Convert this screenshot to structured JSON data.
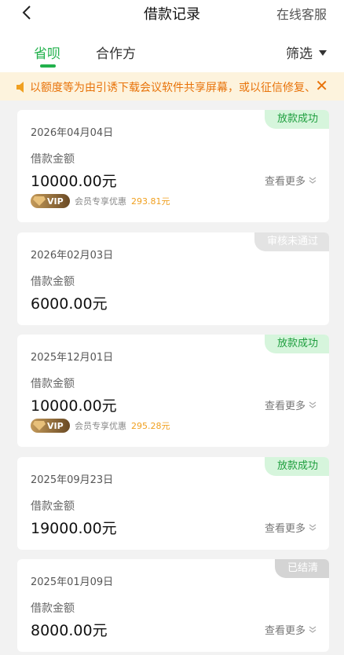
{
  "header": {
    "title": "借款记录",
    "service_label": "在线客服"
  },
  "tabs": [
    {
      "label": "省呗",
      "active": true
    },
    {
      "label": "合作方",
      "active": false
    }
  ],
  "filter_label": "筛选",
  "notice": {
    "text": "以额度等为由引诱下载会议软件共享屏幕，或以征信修复、"
  },
  "common": {
    "amount_label": "借款金额",
    "more_label": "查看更多",
    "vip_label": "VIP",
    "vip_text": "会员专享优惠"
  },
  "records": [
    {
      "date": "2026年04月04日",
      "amount": "10000.00元",
      "status": "放款成功",
      "vip_amount": "293.81元"
    },
    {
      "date": "2026年02月03日",
      "amount": "6000.00元",
      "status": "审核未通过"
    },
    {
      "date": "2025年12月01日",
      "amount": "10000.00元",
      "status": "放款成功",
      "vip_amount": "295.28元"
    },
    {
      "date": "2025年09月23日",
      "amount": "19000.00元",
      "status": "放款成功"
    },
    {
      "date": "2025年01月09日",
      "amount": "8000.00元",
      "status": "已结清"
    }
  ],
  "colors": {
    "accent": "#22b14c",
    "notice": "#e8730a",
    "notice_bg": "#fdf3dd"
  }
}
